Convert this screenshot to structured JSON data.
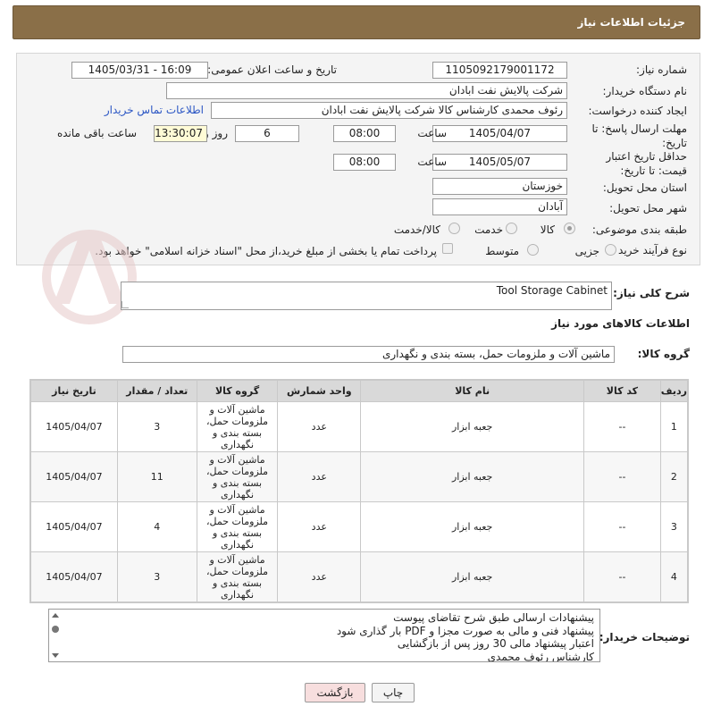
{
  "header": {
    "title": "جزئیات اطلاعات نیاز"
  },
  "fields": {
    "need_number_label": "شماره نیاز:",
    "need_number": "1105092179001172",
    "announce_label": "تاریخ و ساعت اعلان عمومی:",
    "announce_value": "1405/03/31 - 16:09",
    "buyer_org_label": "نام دستگاه خریدار:",
    "buyer_org": "شرکت پالایش نفت ابادان",
    "requester_label": "ایجاد کننده درخواست:",
    "requester": "رئوف محمدی کارشناس کالا شرکت پالایش نفت ابادان",
    "contact_link": "اطلاعات تماس خریدار",
    "reply_deadline_label": "مهلت ارسال پاسخ: تا تاریخ:",
    "reply_date": "1405/04/07",
    "time_label": "ساعت",
    "reply_time": "08:00",
    "days_value": "6",
    "days_label": "روز و",
    "remaining_time": "13:30:07",
    "remaining_label": "ساعت باقی مانده",
    "price_validity_label": "حداقل تاریخ اعتبار قیمت: تا تاریخ:",
    "price_date": "1405/05/07",
    "price_time": "08:00",
    "province_label": "استان محل تحویل:",
    "province": "خوزستان",
    "city_label": "شهر محل تحویل:",
    "city": "آبادان",
    "category_label": "طبقه بندی موضوعی:",
    "category_options": [
      "کالا",
      "خدمت",
      "کالا/خدمت"
    ],
    "category_selected": "کالا",
    "process_label": "نوع فرآیند خرید :",
    "process_options": [
      "جزیی",
      "متوسط"
    ],
    "process_selected": "جزیی",
    "payment_text": "پرداخت تمام یا بخشی از مبلغ خرید،از محل \"اسناد خزانه اسلامی\" خواهد بود."
  },
  "description": {
    "label": "شرح کلی نیاز:",
    "value": "Tool Storage Cabinet"
  },
  "goods": {
    "section_title": "اطلاعات کالاهای مورد نیاز",
    "group_label": "گروه کالا:",
    "group_value": "ماشین آلات و ملزومات حمل، بسته بندی و نگهداری"
  },
  "table": {
    "headers": [
      "ردیف",
      "کد کالا",
      "نام کالا",
      "واحد شمارش",
      "گروه کالا",
      "تعداد / مقدار",
      "تاریخ نیاز"
    ],
    "rows": [
      [
        "1",
        "--",
        "جعبه ابزار",
        "عدد",
        "ماشین آلات و ملزومات حمل، بسته بندی و نگهداری",
        "3",
        "1405/04/07"
      ],
      [
        "2",
        "--",
        "جعبه ابزار",
        "عدد",
        "ماشین آلات و ملزومات حمل، بسته بندی و نگهداری",
        "11",
        "1405/04/07"
      ],
      [
        "3",
        "--",
        "جعبه ابزار",
        "عدد",
        "ماشین آلات و ملزومات حمل، بسته بندی و نگهداری",
        "4",
        "1405/04/07"
      ],
      [
        "4",
        "--",
        "جعبه ابزار",
        "عدد",
        "ماشین آلات و ملزومات حمل، بسته بندی و نگهداری",
        "3",
        "1405/04/07"
      ]
    ]
  },
  "notes": {
    "label": "توضیحات خریدار:",
    "lines": [
      "پیشنهادات ارسالی طبق شرح تقاضای پیوست",
      "پیشنهاد فنی و مالی به صورت مجزا و PDF بار گذاری شود",
      "اعتبار پیشنهاد مالی 30 روز پس از بازگشایی",
      "کارشناس رئوف  محمدی"
    ]
  },
  "buttons": {
    "print": "چاپ",
    "back": "بازگشت"
  },
  "colors": {
    "header_bg": "#8a6f48",
    "link": "#2b56c4",
    "back_btn": "#f7dede"
  }
}
